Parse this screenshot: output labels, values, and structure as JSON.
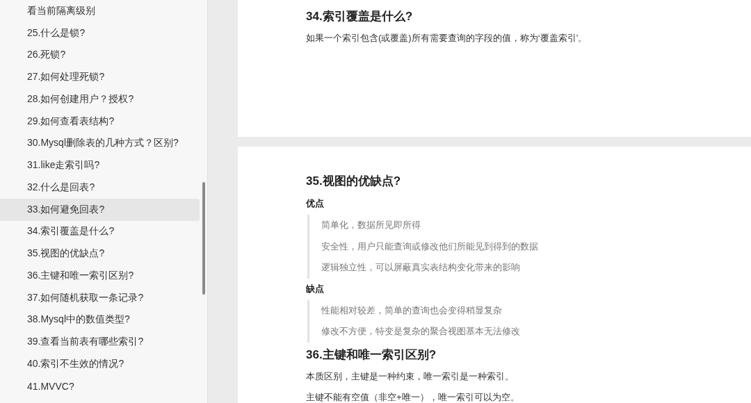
{
  "sidebar": {
    "items": [
      {
        "label": "看当前隔离级别",
        "selected": false
      },
      {
        "label": "25.什么是锁?",
        "selected": false
      },
      {
        "label": "26.死锁?",
        "selected": false
      },
      {
        "label": "27.如何处理死锁?",
        "selected": false
      },
      {
        "label": "28.如何创建用户？授权?",
        "selected": false
      },
      {
        "label": "29.如何查看表结构?",
        "selected": false
      },
      {
        "label": "30.Mysql删除表的几种方式？区别?",
        "selected": false
      },
      {
        "label": "31.like走索引吗?",
        "selected": false
      },
      {
        "label": "32.什么是回表?",
        "selected": false
      },
      {
        "label": "33.如何避免回表?",
        "selected": true
      },
      {
        "label": "34.索引覆盖是什么?",
        "selected": false
      },
      {
        "label": "35.视图的优缺点?",
        "selected": false
      },
      {
        "label": "36.主键和唯一索引区别?",
        "selected": false
      },
      {
        "label": "37.如何随机获取一条记录?",
        "selected": false
      },
      {
        "label": "38.Mysql中的数值类型?",
        "selected": false
      },
      {
        "label": "39.查看当前表有哪些索引?",
        "selected": false
      },
      {
        "label": "40.索引不生效的情况?",
        "selected": false
      },
      {
        "label": "41.MVVC?",
        "selected": false
      }
    ]
  },
  "pages": [
    {
      "blocks": [
        {
          "kind": "heading",
          "text": "34.索引覆盖是什么?"
        },
        {
          "kind": "paragraph",
          "text": "如果一个索引包含(或覆盖)所有需要查询的字段的值，称为‘覆盖索引’。"
        }
      ]
    },
    {
      "blocks": [
        {
          "kind": "heading",
          "text": "35.视图的优缺点?"
        },
        {
          "kind": "subheading",
          "text": "优点"
        },
        {
          "kind": "quote",
          "lines": [
            "简单化，数据所见即所得",
            "安全性，用户只能查询或修改他们所能见到得到的数据",
            "逻辑独立性，可以屏蔽真实表结构变化带来的影响"
          ]
        },
        {
          "kind": "subheading",
          "text": "缺点"
        },
        {
          "kind": "quote",
          "lines": [
            "性能相对较差，简单的查询也会变得稍显复杂",
            "修改不方便，特变是复杂的聚合视图基本无法修改"
          ]
        },
        {
          "kind": "heading",
          "text": "36.主键和唯一索引区别?"
        },
        {
          "kind": "paragraph",
          "text": "本质区别，主键是一种约束，唯一索引是一种索引。"
        },
        {
          "kind": "paragraph",
          "text": "主键不能有空值（非空+唯一），唯一索引可以为空。"
        }
      ]
    }
  ]
}
